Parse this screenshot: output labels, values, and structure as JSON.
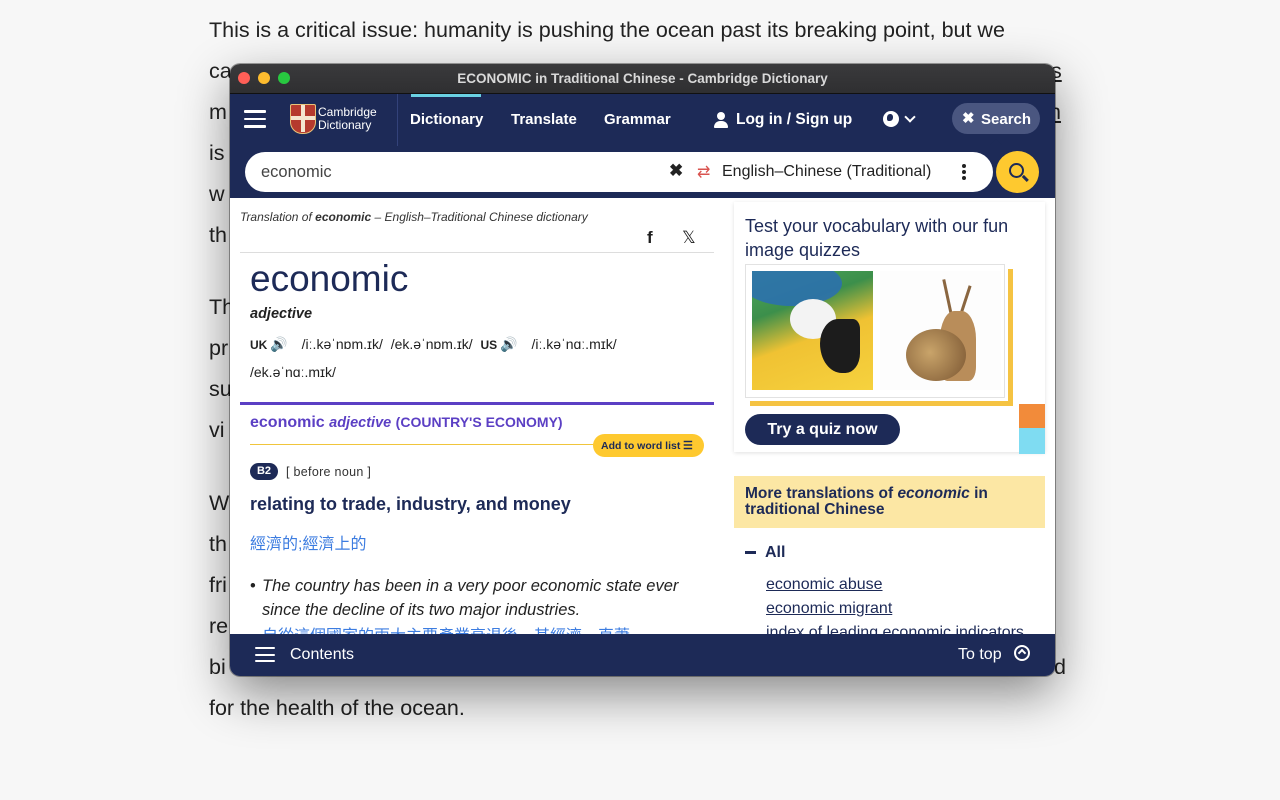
{
  "article": {
    "lines": [
      {
        "text": "This is a critical issue: humanity is pushing the ocean past its breaking point, but we"
      },
      {
        "text": "ca"
      },
      {
        "text": "m"
      },
      {
        "text": "is"
      },
      {
        "text": "w"
      },
      {
        "text": "th"
      },
      {
        "text": "Th"
      },
      {
        "text": "pr"
      },
      {
        "text": "su"
      },
      {
        "text": "vi"
      },
      {
        "text": "W"
      },
      {
        "text": "th"
      },
      {
        "text": "fri"
      },
      {
        "text": "re"
      },
      {
        "text": "bi"
      },
      {
        "text": "for the health of the ocean."
      }
    ],
    "right_edge_fragments": [
      "s",
      "n",
      "d"
    ]
  },
  "window": {
    "title": "ECONOMIC in Traditional Chinese - Cambridge Dictionary"
  },
  "nav": {
    "logo_line1": "Cambridge",
    "logo_line2": "Dictionary",
    "links": {
      "dictionary": "Dictionary",
      "translate": "Translate",
      "grammar": "Grammar"
    },
    "login": "Log in / Sign up",
    "search_toggle": "Search"
  },
  "search": {
    "query": "economic",
    "language": "English–Chinese (Traditional)"
  },
  "entry": {
    "header_prefix": "Translation of ",
    "header_word": "economic",
    "header_suffix": " – English–Traditional Chinese dictionary",
    "share_facebook": "f",
    "share_x": "𝕏",
    "headword": "economic",
    "pos": "adjective",
    "uk_label": "UK",
    "uk_pron_1": "/iː.kəˈnɒm.ɪk/",
    "uk_pron_2": "/ek.əˈnɒm.ɪk/",
    "us_label": "US",
    "us_pron_1": "/iː.kəˈnɑː.mɪk/",
    "us_pron_2": "/ek.əˈnɑː.mɪk/",
    "sense_word": "economic",
    "sense_pos": "adjective",
    "sense_guide": "(COUNTRY'S ECONOMY)",
    "add_to_word_list": "Add to word list",
    "level": "B2",
    "grammar": "[ before noun ]",
    "definition": "relating to trade, industry, and money",
    "translation": "經濟的;經濟上的",
    "example": "The country has been in a very poor economic state ever since the decline of its two major industries.",
    "example_translation": "自從這個國家的兩大主要產業衰退後，其經濟一直蕭"
  },
  "sidebar": {
    "quiz_title": "Test your vocabulary with our fun image quizzes",
    "quiz_button": "Try a quiz now",
    "more_prefix": "More translations of ",
    "more_word": "economic",
    "more_suffix": " in traditional Chinese",
    "all_label": "All",
    "links": [
      "economic abuse",
      "economic migrant",
      "index of leading economic indicators"
    ]
  },
  "bottom": {
    "contents": "Contents",
    "to_top": "To top"
  },
  "colors": {
    "navy": "#1d2a57",
    "accent_yellow": "#fec92f",
    "purple": "#5b3fc4",
    "chinese_blue": "#3c7ce0"
  }
}
